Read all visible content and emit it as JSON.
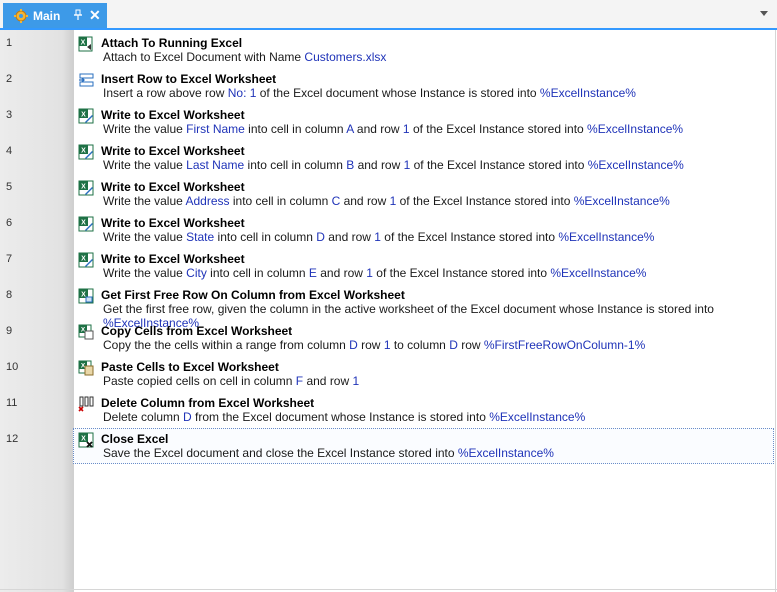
{
  "tab": {
    "label": "Main",
    "close": "✕"
  },
  "colors": {
    "accent": "#3d9ae8",
    "variable": "#1f33b8"
  },
  "rows": [
    {
      "num": "1",
      "icon": "excel-attach-icon",
      "title": "Attach To Running Excel",
      "desc": [
        {
          "t": "Attach to Excel Document with Name "
        },
        {
          "v": "Customers.xlsx"
        }
      ]
    },
    {
      "num": "2",
      "icon": "insert-row-icon",
      "title": "Insert Row to Excel Worksheet",
      "desc": [
        {
          "t": "Insert a row above row "
        },
        {
          "v": "No: 1"
        },
        {
          "t": " of the Excel document whose Instance is stored into "
        },
        {
          "v": "%ExcelInstance%"
        }
      ]
    },
    {
      "num": "3",
      "icon": "excel-write-icon",
      "title": "Write to Excel Worksheet",
      "desc": [
        {
          "t": "Write the value "
        },
        {
          "v": "First Name"
        },
        {
          "t": " into cell in column "
        },
        {
          "v": "A"
        },
        {
          "t": " and row "
        },
        {
          "v": "1"
        },
        {
          "t": " of the Excel Instance stored into "
        },
        {
          "v": "%ExcelInstance%"
        }
      ]
    },
    {
      "num": "4",
      "icon": "excel-write-icon",
      "title": "Write to Excel Worksheet",
      "desc": [
        {
          "t": "Write the value "
        },
        {
          "v": "Last Name"
        },
        {
          "t": " into cell in column "
        },
        {
          "v": "B"
        },
        {
          "t": " and row "
        },
        {
          "v": "1"
        },
        {
          "t": " of the Excel Instance stored into "
        },
        {
          "v": "%ExcelInstance%"
        }
      ]
    },
    {
      "num": "5",
      "icon": "excel-write-icon",
      "title": "Write to Excel Worksheet",
      "desc": [
        {
          "t": "Write the value "
        },
        {
          "v": "Address"
        },
        {
          "t": " into cell in column "
        },
        {
          "v": "C"
        },
        {
          "t": " and row "
        },
        {
          "v": "1"
        },
        {
          "t": " of the Excel Instance stored into "
        },
        {
          "v": "%ExcelInstance%"
        }
      ]
    },
    {
      "num": "6",
      "icon": "excel-write-icon",
      "title": "Write to Excel Worksheet",
      "desc": [
        {
          "t": "Write the value "
        },
        {
          "v": "State"
        },
        {
          "t": " into cell in column "
        },
        {
          "v": "D"
        },
        {
          "t": " and row "
        },
        {
          "v": "1"
        },
        {
          "t": " of the Excel Instance stored into "
        },
        {
          "v": "%ExcelInstance%"
        }
      ]
    },
    {
      "num": "7",
      "icon": "excel-write-icon",
      "title": "Write to Excel Worksheet",
      "desc": [
        {
          "t": "Write the value "
        },
        {
          "v": "City"
        },
        {
          "t": " into cell in column "
        },
        {
          "v": "E"
        },
        {
          "t": " and row "
        },
        {
          "v": "1"
        },
        {
          "t": " of the Excel Instance stored into "
        },
        {
          "v": "%ExcelInstance%"
        }
      ]
    },
    {
      "num": "8",
      "icon": "excel-free-row-icon",
      "title": "Get First Free Row On Column from Excel Worksheet",
      "wrap": true,
      "desc": [
        {
          "t": "Get the first free row, given the column in the active worksheet of the Excel document whose Instance is stored into "
        },
        {
          "v": "%ExcelInstance%"
        }
      ]
    },
    {
      "num": "9",
      "icon": "excel-copy-icon",
      "title": "Copy Cells from Excel Worksheet",
      "desc": [
        {
          "t": "Copy the the cells within a range from column "
        },
        {
          "v": "D"
        },
        {
          "t": " row "
        },
        {
          "v": "1"
        },
        {
          "t": " to column "
        },
        {
          "v": "D"
        },
        {
          "t": " row "
        },
        {
          "v": "%FirstFreeRowOnColumn-1%"
        }
      ]
    },
    {
      "num": "10",
      "icon": "excel-paste-icon",
      "title": "Paste Cells to Excel Worksheet",
      "desc": [
        {
          "t": "Paste copied cells on cell in column "
        },
        {
          "v": "F"
        },
        {
          "t": " and row "
        },
        {
          "v": "1"
        }
      ]
    },
    {
      "num": "11",
      "icon": "delete-column-icon",
      "title": "Delete Column from Excel Worksheet",
      "desc": [
        {
          "t": "Delete column "
        },
        {
          "v": "D"
        },
        {
          "t": " from the Excel document whose Instance is stored into "
        },
        {
          "v": "%ExcelInstance%"
        }
      ]
    },
    {
      "num": "12",
      "icon": "excel-close-icon",
      "title": "Close Excel",
      "selected": true,
      "desc": [
        {
          "t": "Save the Excel document and close the Excel Instance stored into "
        },
        {
          "v": "%ExcelInstance%"
        }
      ]
    }
  ]
}
